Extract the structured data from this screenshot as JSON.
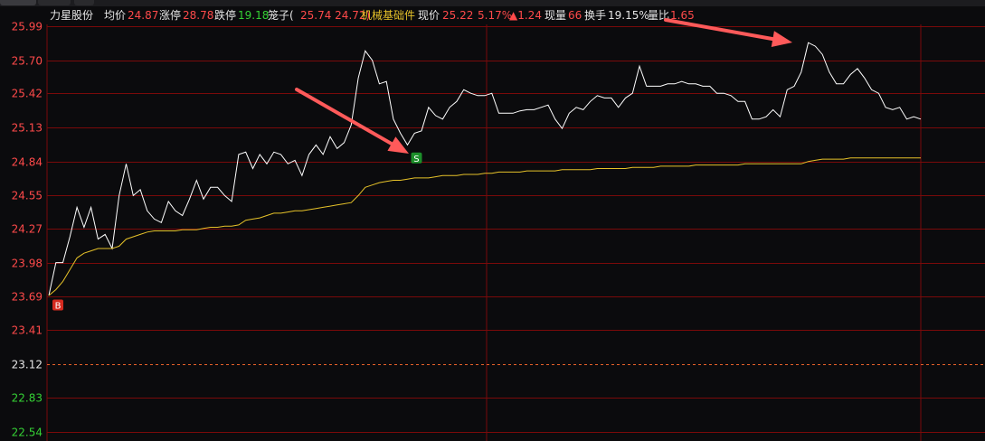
{
  "header": {
    "stock_name": "力星股份",
    "avg_label": "均价",
    "avg_value": "24.87",
    "limit_up_label": "涨停",
    "limit_up_value": "28.78",
    "limit_down_label": "跌停",
    "limit_down_value": "19.18",
    "bid_ask_label": "笼子(",
    "bid_ask_value": "25.74 24.72)",
    "industry": "机械基础件",
    "price_label": "现价",
    "price_value": "25.22",
    "change_pct": "5.17%",
    "change_value": "▲1.24",
    "volume_label": "现量",
    "volume_value": "66",
    "turnover_label": "换手",
    "turnover_value": "19.15%",
    "vol_ratio_label": "量比",
    "vol_ratio_value": "1.65"
  },
  "colors": {
    "background": "#0b0b0d",
    "grid": "#7a0a0a",
    "price_line": "#ffffff",
    "avg_line": "#e6c229",
    "up_tick": "#ff4a4a",
    "down_tick": "#35d135",
    "arrow": "#ff5a5a"
  },
  "chart_data": {
    "type": "line",
    "title": "",
    "xlabel": "",
    "ylabel": "",
    "ylim": [
      22.54,
      25.99
    ],
    "y_ticks": [
      "25.99",
      "25.70",
      "25.42",
      "25.13",
      "24.84",
      "24.55",
      "24.27",
      "23.98",
      "23.69",
      "23.41",
      "23.12",
      "22.83",
      "22.54"
    ],
    "prev_close": 23.12,
    "grid": true,
    "series": [
      {
        "values": [
          23.7,
          23.98,
          23.98,
          24.2,
          24.45,
          24.28,
          24.45,
          24.18,
          24.22,
          24.1,
          24.55,
          24.82,
          24.55,
          24.6,
          24.42,
          24.35,
          24.32,
          24.5,
          24.42,
          24.38,
          24.52,
          24.68,
          24.52,
          24.62,
          24.62,
          24.55,
          24.5,
          24.9,
          24.92,
          24.78,
          24.9,
          24.82,
          24.92,
          24.9,
          24.82,
          24.85,
          24.72,
          24.9,
          24.98,
          24.9,
          25.05,
          24.95,
          25.0,
          25.15,
          25.55,
          25.78,
          25.7,
          25.5,
          25.52,
          25.2,
          25.08,
          24.98,
          25.08,
          25.1,
          25.3,
          25.23,
          25.2,
          25.3,
          25.35,
          25.45,
          25.42,
          25.4,
          25.4,
          25.42,
          25.25,
          25.25,
          25.25,
          25.27,
          25.28,
          25.28,
          25.3,
          25.32,
          25.2,
          25.12,
          25.25,
          25.3,
          25.28,
          25.35,
          25.4,
          25.38,
          25.38,
          25.3,
          25.38,
          25.42,
          25.65,
          25.48,
          25.48,
          25.48,
          25.5,
          25.5,
          25.52,
          25.5,
          25.5,
          25.48,
          25.48,
          25.42,
          25.42,
          25.4,
          25.35,
          25.35,
          25.2,
          25.2,
          25.22,
          25.28,
          25.22,
          25.45,
          25.48,
          25.6,
          25.85,
          25.82,
          25.75,
          25.6,
          25.5,
          25.5,
          25.58,
          25.63,
          25.55,
          25.45,
          25.42,
          25.3,
          25.28,
          25.3,
          25.2,
          25.22,
          25.2
        ]
      },
      {
        "values": [
          23.7,
          23.75,
          23.82,
          23.92,
          24.02,
          24.06,
          24.08,
          24.1,
          24.1,
          24.1,
          24.12,
          24.18,
          24.2,
          24.22,
          24.24,
          24.25,
          24.25,
          24.25,
          24.25,
          24.26,
          24.26,
          24.26,
          24.27,
          24.28,
          24.28,
          24.29,
          24.29,
          24.3,
          24.34,
          24.35,
          24.36,
          24.38,
          24.4,
          24.4,
          24.41,
          24.42,
          24.42,
          24.43,
          24.44,
          24.45,
          24.46,
          24.47,
          24.48,
          24.49,
          24.55,
          24.62,
          24.64,
          24.66,
          24.67,
          24.68,
          24.68,
          24.69,
          24.7,
          24.7,
          24.7,
          24.71,
          24.72,
          24.72,
          24.72,
          24.73,
          24.73,
          24.73,
          24.74,
          24.74,
          24.75,
          24.75,
          24.75,
          24.75,
          24.76,
          24.76,
          24.76,
          24.76,
          24.76,
          24.77,
          24.77,
          24.77,
          24.77,
          24.77,
          24.78,
          24.78,
          24.78,
          24.78,
          24.78,
          24.79,
          24.79,
          24.79,
          24.79,
          24.8,
          24.8,
          24.8,
          24.8,
          24.8,
          24.81,
          24.81,
          24.81,
          24.81,
          24.81,
          24.81,
          24.81,
          24.82,
          24.82,
          24.82,
          24.82,
          24.82,
          24.82,
          24.82,
          24.82,
          24.82,
          24.84,
          24.85,
          24.86,
          24.86,
          24.86,
          24.86,
          24.87,
          24.87,
          24.87,
          24.87,
          24.87,
          24.87,
          24.87,
          24.87,
          24.87,
          24.87,
          24.87
        ]
      }
    ],
    "markers": [
      {
        "label": "B",
        "index": 0,
        "y": 23.62,
        "color": "#d42a1f"
      },
      {
        "label": "S",
        "index": 51,
        "y": 24.87,
        "color": "#1c8f2a"
      }
    ]
  }
}
